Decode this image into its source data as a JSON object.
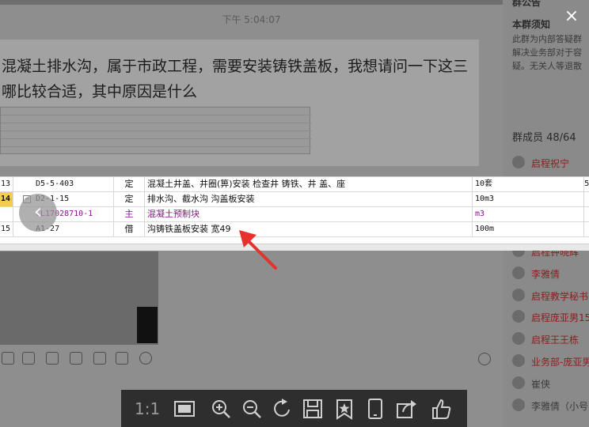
{
  "background_chat": {
    "timestamp": "下午 5:04:07",
    "message_line1": "混凝土排水沟，属于市政工程，需要安装铸铁盖板，我想请问一下这三",
    "message_line2": "哪比较合适，其中原因是什么"
  },
  "side_panel": {
    "header": "群公告",
    "notice_title": "本群须知",
    "notice_lines": [
      "此群为内部答疑群",
      "解决业务部对于容",
      "疑。无关人等退散"
    ],
    "member_count_label": "群成员 48/64",
    "members": [
      {
        "name": "启程祝宁",
        "color": "#8b1e1e"
      },
      {
        "name": "启程钟晓辉",
        "color": "#8b1e1e"
      },
      {
        "name": "李雅倩",
        "color": "#8b1e1e"
      },
      {
        "name": "启程教学秘书",
        "color": "#8b1e1e"
      },
      {
        "name": "启程庞亚男15",
        "color": "#8b1e1e"
      },
      {
        "name": "启程王王栋",
        "color": "#8b1e1e"
      },
      {
        "name": "业务部-庞亚男",
        "color": "#8b1e1e"
      },
      {
        "name": "崔侠",
        "color": "#3b3b3b"
      },
      {
        "name": "李雅倩（小号",
        "color": "#3b3b3b"
      }
    ]
  },
  "spreadsheet": {
    "rows": [
      {
        "num": "13",
        "code": "D5-5-403",
        "type": "定",
        "name": "混凝土井盖、井圈(箅)安装 检查井 铸铁、井 盖、座",
        "unit": "10套",
        "extra": "5",
        "style": "normal"
      },
      {
        "num": "14",
        "code": "D2-1-15",
        "type": "定",
        "name": "排水沟、截水沟 沟盖板安装",
        "unit": "10m3",
        "extra": "",
        "style": "active"
      },
      {
        "num": "",
        "code": "CL17028710-1",
        "type": "主",
        "name": "混凝土预制块",
        "unit": "m3",
        "extra": "",
        "style": "material"
      },
      {
        "num": "15",
        "code": "A1-27",
        "type": "借",
        "name": "沟铸铁盖板安装 宽49",
        "unit": "100m",
        "extra": "",
        "style": "normal"
      }
    ]
  },
  "viewer": {
    "close_icon": "×",
    "prev_icon": "‹",
    "ratio_label": "1:1",
    "tools": [
      "fit-window-icon",
      "zoom-in-icon",
      "zoom-out-icon",
      "rotate-icon",
      "save-icon",
      "favorite-icon",
      "phone-icon",
      "share-icon",
      "thumbs-up-icon"
    ],
    "arrow_color": "#e8302c"
  }
}
